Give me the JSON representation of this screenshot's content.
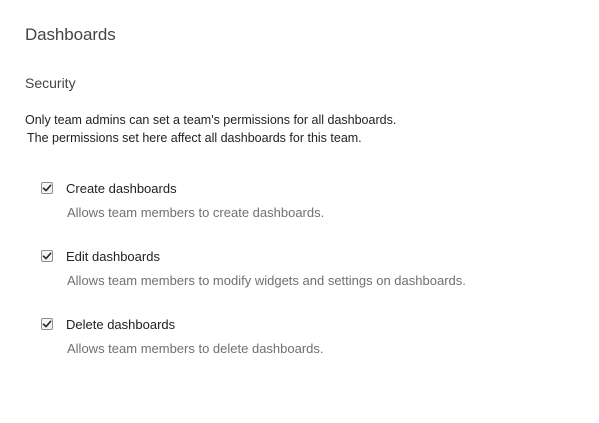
{
  "page": {
    "title": "Dashboards"
  },
  "security": {
    "title": "Security",
    "description_line1": "Only team admins can set a team's permissions for all dashboards.",
    "description_line2": "The permissions set here affect all dashboards for this team."
  },
  "permissions": [
    {
      "label": "Create dashboards",
      "description": "Allows team members to create dashboards.",
      "checked": true
    },
    {
      "label": "Edit dashboards",
      "description": "Allows team members to modify widgets and settings on dashboards.",
      "checked": true
    },
    {
      "label": "Delete dashboards",
      "description": "Allows team members to delete dashboards.",
      "checked": true
    }
  ],
  "icons": {
    "checkbox": "checkmark-icon"
  },
  "colors": {
    "heading": "#444444",
    "text": "#222222",
    "muted": "#707070",
    "checkbox_border": "#8f8f8f"
  }
}
